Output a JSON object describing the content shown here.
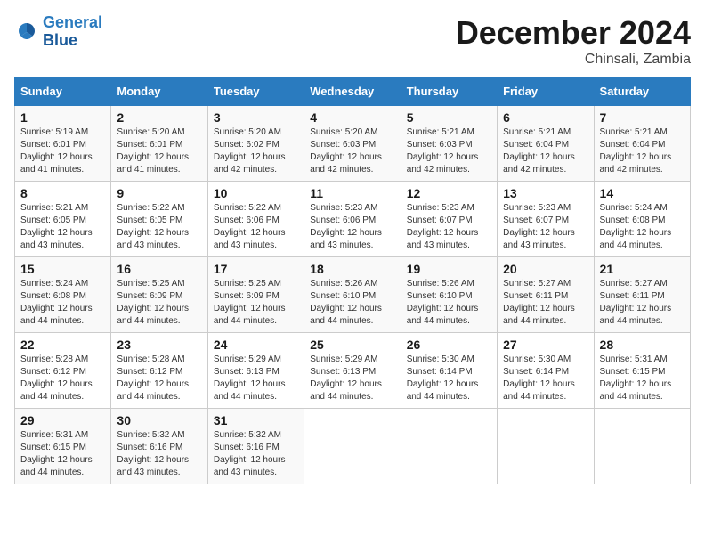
{
  "header": {
    "logo_line1": "General",
    "logo_line2": "Blue",
    "month": "December 2024",
    "location": "Chinsali, Zambia"
  },
  "weekdays": [
    "Sunday",
    "Monday",
    "Tuesday",
    "Wednesday",
    "Thursday",
    "Friday",
    "Saturday"
  ],
  "weeks": [
    [
      {
        "day": "1",
        "info": "Sunrise: 5:19 AM\nSunset: 6:01 PM\nDaylight: 12 hours and 41 minutes."
      },
      {
        "day": "2",
        "info": "Sunrise: 5:20 AM\nSunset: 6:01 PM\nDaylight: 12 hours and 41 minutes."
      },
      {
        "day": "3",
        "info": "Sunrise: 5:20 AM\nSunset: 6:02 PM\nDaylight: 12 hours and 42 minutes."
      },
      {
        "day": "4",
        "info": "Sunrise: 5:20 AM\nSunset: 6:03 PM\nDaylight: 12 hours and 42 minutes."
      },
      {
        "day": "5",
        "info": "Sunrise: 5:21 AM\nSunset: 6:03 PM\nDaylight: 12 hours and 42 minutes."
      },
      {
        "day": "6",
        "info": "Sunrise: 5:21 AM\nSunset: 6:04 PM\nDaylight: 12 hours and 42 minutes."
      },
      {
        "day": "7",
        "info": "Sunrise: 5:21 AM\nSunset: 6:04 PM\nDaylight: 12 hours and 42 minutes."
      }
    ],
    [
      {
        "day": "8",
        "info": "Sunrise: 5:21 AM\nSunset: 6:05 PM\nDaylight: 12 hours and 43 minutes."
      },
      {
        "day": "9",
        "info": "Sunrise: 5:22 AM\nSunset: 6:05 PM\nDaylight: 12 hours and 43 minutes."
      },
      {
        "day": "10",
        "info": "Sunrise: 5:22 AM\nSunset: 6:06 PM\nDaylight: 12 hours and 43 minutes."
      },
      {
        "day": "11",
        "info": "Sunrise: 5:23 AM\nSunset: 6:06 PM\nDaylight: 12 hours and 43 minutes."
      },
      {
        "day": "12",
        "info": "Sunrise: 5:23 AM\nSunset: 6:07 PM\nDaylight: 12 hours and 43 minutes."
      },
      {
        "day": "13",
        "info": "Sunrise: 5:23 AM\nSunset: 6:07 PM\nDaylight: 12 hours and 43 minutes."
      },
      {
        "day": "14",
        "info": "Sunrise: 5:24 AM\nSunset: 6:08 PM\nDaylight: 12 hours and 44 minutes."
      }
    ],
    [
      {
        "day": "15",
        "info": "Sunrise: 5:24 AM\nSunset: 6:08 PM\nDaylight: 12 hours and 44 minutes."
      },
      {
        "day": "16",
        "info": "Sunrise: 5:25 AM\nSunset: 6:09 PM\nDaylight: 12 hours and 44 minutes."
      },
      {
        "day": "17",
        "info": "Sunrise: 5:25 AM\nSunset: 6:09 PM\nDaylight: 12 hours and 44 minutes."
      },
      {
        "day": "18",
        "info": "Sunrise: 5:26 AM\nSunset: 6:10 PM\nDaylight: 12 hours and 44 minutes."
      },
      {
        "day": "19",
        "info": "Sunrise: 5:26 AM\nSunset: 6:10 PM\nDaylight: 12 hours and 44 minutes."
      },
      {
        "day": "20",
        "info": "Sunrise: 5:27 AM\nSunset: 6:11 PM\nDaylight: 12 hours and 44 minutes."
      },
      {
        "day": "21",
        "info": "Sunrise: 5:27 AM\nSunset: 6:11 PM\nDaylight: 12 hours and 44 minutes."
      }
    ],
    [
      {
        "day": "22",
        "info": "Sunrise: 5:28 AM\nSunset: 6:12 PM\nDaylight: 12 hours and 44 minutes."
      },
      {
        "day": "23",
        "info": "Sunrise: 5:28 AM\nSunset: 6:12 PM\nDaylight: 12 hours and 44 minutes."
      },
      {
        "day": "24",
        "info": "Sunrise: 5:29 AM\nSunset: 6:13 PM\nDaylight: 12 hours and 44 minutes."
      },
      {
        "day": "25",
        "info": "Sunrise: 5:29 AM\nSunset: 6:13 PM\nDaylight: 12 hours and 44 minutes."
      },
      {
        "day": "26",
        "info": "Sunrise: 5:30 AM\nSunset: 6:14 PM\nDaylight: 12 hours and 44 minutes."
      },
      {
        "day": "27",
        "info": "Sunrise: 5:30 AM\nSunset: 6:14 PM\nDaylight: 12 hours and 44 minutes."
      },
      {
        "day": "28",
        "info": "Sunrise: 5:31 AM\nSunset: 6:15 PM\nDaylight: 12 hours and 44 minutes."
      }
    ],
    [
      {
        "day": "29",
        "info": "Sunrise: 5:31 AM\nSunset: 6:15 PM\nDaylight: 12 hours and 44 minutes."
      },
      {
        "day": "30",
        "info": "Sunrise: 5:32 AM\nSunset: 6:16 PM\nDaylight: 12 hours and 43 minutes."
      },
      {
        "day": "31",
        "info": "Sunrise: 5:32 AM\nSunset: 6:16 PM\nDaylight: 12 hours and 43 minutes."
      },
      null,
      null,
      null,
      null
    ]
  ]
}
